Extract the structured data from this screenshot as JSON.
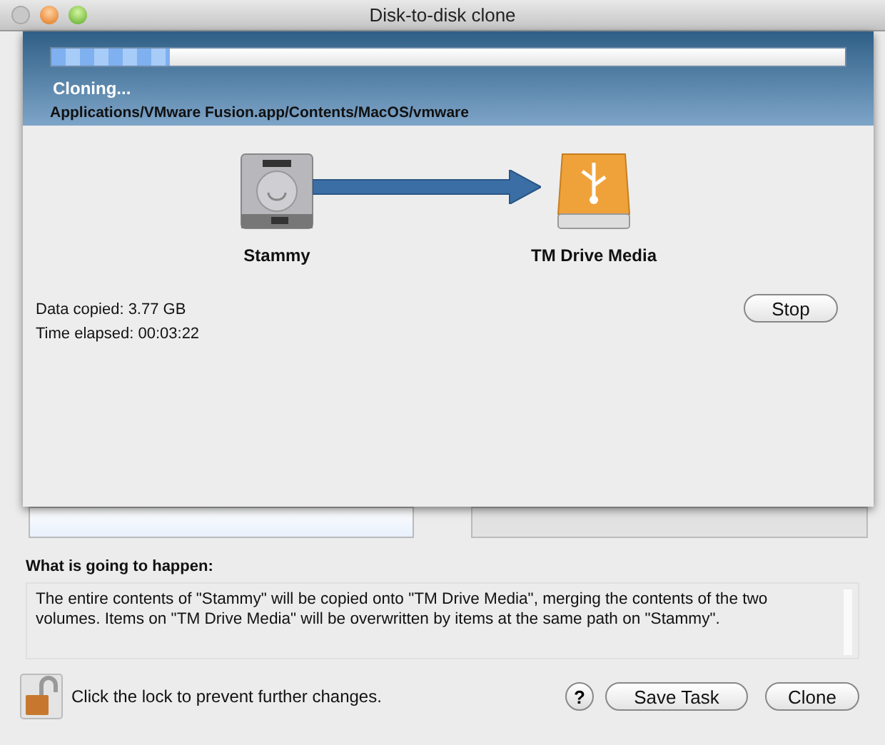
{
  "window": {
    "title": "Disk-to-disk clone"
  },
  "sheet": {
    "progress": {
      "level": 0.15
    },
    "status": "Cloning...",
    "current_file": "Applications/VMware Fusion.app/Contents/MacOS/vmware",
    "source": {
      "name": "Stammy"
    },
    "target": {
      "name": "TM Drive Media"
    },
    "stats": [
      "Data copied: 3.77 GB",
      "Time elapsed: 00:03:22"
    ],
    "stop_button": "Stop"
  },
  "summary": {
    "heading": "What is going to happen:",
    "text": "The entire contents of \"Stammy\" will be copied onto \"TM Drive Media\", merging the contents of the two volumes. Items on \"TM Drive Media\" will be overwritten by items at the same path on \"Stammy\"."
  },
  "footer": {
    "lock": {
      "locked": false
    },
    "lock_text": "Click the lock to prevent further changes.",
    "help": "?",
    "buttons": [
      "Save Task",
      "Clone"
    ]
  }
}
